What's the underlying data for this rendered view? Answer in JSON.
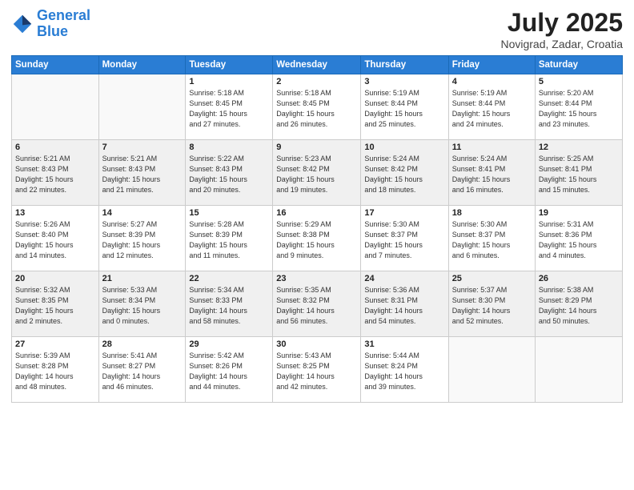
{
  "header": {
    "logo_general": "General",
    "logo_blue": "Blue",
    "month_year": "July 2025",
    "location": "Novigrad, Zadar, Croatia"
  },
  "weekdays": [
    "Sunday",
    "Monday",
    "Tuesday",
    "Wednesday",
    "Thursday",
    "Friday",
    "Saturday"
  ],
  "weeks": [
    [
      {
        "day": "",
        "info": ""
      },
      {
        "day": "",
        "info": ""
      },
      {
        "day": "1",
        "info": "Sunrise: 5:18 AM\nSunset: 8:45 PM\nDaylight: 15 hours\nand 27 minutes."
      },
      {
        "day": "2",
        "info": "Sunrise: 5:18 AM\nSunset: 8:45 PM\nDaylight: 15 hours\nand 26 minutes."
      },
      {
        "day": "3",
        "info": "Sunrise: 5:19 AM\nSunset: 8:44 PM\nDaylight: 15 hours\nand 25 minutes."
      },
      {
        "day": "4",
        "info": "Sunrise: 5:19 AM\nSunset: 8:44 PM\nDaylight: 15 hours\nand 24 minutes."
      },
      {
        "day": "5",
        "info": "Sunrise: 5:20 AM\nSunset: 8:44 PM\nDaylight: 15 hours\nand 23 minutes."
      }
    ],
    [
      {
        "day": "6",
        "info": "Sunrise: 5:21 AM\nSunset: 8:43 PM\nDaylight: 15 hours\nand 22 minutes."
      },
      {
        "day": "7",
        "info": "Sunrise: 5:21 AM\nSunset: 8:43 PM\nDaylight: 15 hours\nand 21 minutes."
      },
      {
        "day": "8",
        "info": "Sunrise: 5:22 AM\nSunset: 8:43 PM\nDaylight: 15 hours\nand 20 minutes."
      },
      {
        "day": "9",
        "info": "Sunrise: 5:23 AM\nSunset: 8:42 PM\nDaylight: 15 hours\nand 19 minutes."
      },
      {
        "day": "10",
        "info": "Sunrise: 5:24 AM\nSunset: 8:42 PM\nDaylight: 15 hours\nand 18 minutes."
      },
      {
        "day": "11",
        "info": "Sunrise: 5:24 AM\nSunset: 8:41 PM\nDaylight: 15 hours\nand 16 minutes."
      },
      {
        "day": "12",
        "info": "Sunrise: 5:25 AM\nSunset: 8:41 PM\nDaylight: 15 hours\nand 15 minutes."
      }
    ],
    [
      {
        "day": "13",
        "info": "Sunrise: 5:26 AM\nSunset: 8:40 PM\nDaylight: 15 hours\nand 14 minutes."
      },
      {
        "day": "14",
        "info": "Sunrise: 5:27 AM\nSunset: 8:39 PM\nDaylight: 15 hours\nand 12 minutes."
      },
      {
        "day": "15",
        "info": "Sunrise: 5:28 AM\nSunset: 8:39 PM\nDaylight: 15 hours\nand 11 minutes."
      },
      {
        "day": "16",
        "info": "Sunrise: 5:29 AM\nSunset: 8:38 PM\nDaylight: 15 hours\nand 9 minutes."
      },
      {
        "day": "17",
        "info": "Sunrise: 5:30 AM\nSunset: 8:37 PM\nDaylight: 15 hours\nand 7 minutes."
      },
      {
        "day": "18",
        "info": "Sunrise: 5:30 AM\nSunset: 8:37 PM\nDaylight: 15 hours\nand 6 minutes."
      },
      {
        "day": "19",
        "info": "Sunrise: 5:31 AM\nSunset: 8:36 PM\nDaylight: 15 hours\nand 4 minutes."
      }
    ],
    [
      {
        "day": "20",
        "info": "Sunrise: 5:32 AM\nSunset: 8:35 PM\nDaylight: 15 hours\nand 2 minutes."
      },
      {
        "day": "21",
        "info": "Sunrise: 5:33 AM\nSunset: 8:34 PM\nDaylight: 15 hours\nand 0 minutes."
      },
      {
        "day": "22",
        "info": "Sunrise: 5:34 AM\nSunset: 8:33 PM\nDaylight: 14 hours\nand 58 minutes."
      },
      {
        "day": "23",
        "info": "Sunrise: 5:35 AM\nSunset: 8:32 PM\nDaylight: 14 hours\nand 56 minutes."
      },
      {
        "day": "24",
        "info": "Sunrise: 5:36 AM\nSunset: 8:31 PM\nDaylight: 14 hours\nand 54 minutes."
      },
      {
        "day": "25",
        "info": "Sunrise: 5:37 AM\nSunset: 8:30 PM\nDaylight: 14 hours\nand 52 minutes."
      },
      {
        "day": "26",
        "info": "Sunrise: 5:38 AM\nSunset: 8:29 PM\nDaylight: 14 hours\nand 50 minutes."
      }
    ],
    [
      {
        "day": "27",
        "info": "Sunrise: 5:39 AM\nSunset: 8:28 PM\nDaylight: 14 hours\nand 48 minutes."
      },
      {
        "day": "28",
        "info": "Sunrise: 5:41 AM\nSunset: 8:27 PM\nDaylight: 14 hours\nand 46 minutes."
      },
      {
        "day": "29",
        "info": "Sunrise: 5:42 AM\nSunset: 8:26 PM\nDaylight: 14 hours\nand 44 minutes."
      },
      {
        "day": "30",
        "info": "Sunrise: 5:43 AM\nSunset: 8:25 PM\nDaylight: 14 hours\nand 42 minutes."
      },
      {
        "day": "31",
        "info": "Sunrise: 5:44 AM\nSunset: 8:24 PM\nDaylight: 14 hours\nand 39 minutes."
      },
      {
        "day": "",
        "info": ""
      },
      {
        "day": "",
        "info": ""
      }
    ]
  ]
}
